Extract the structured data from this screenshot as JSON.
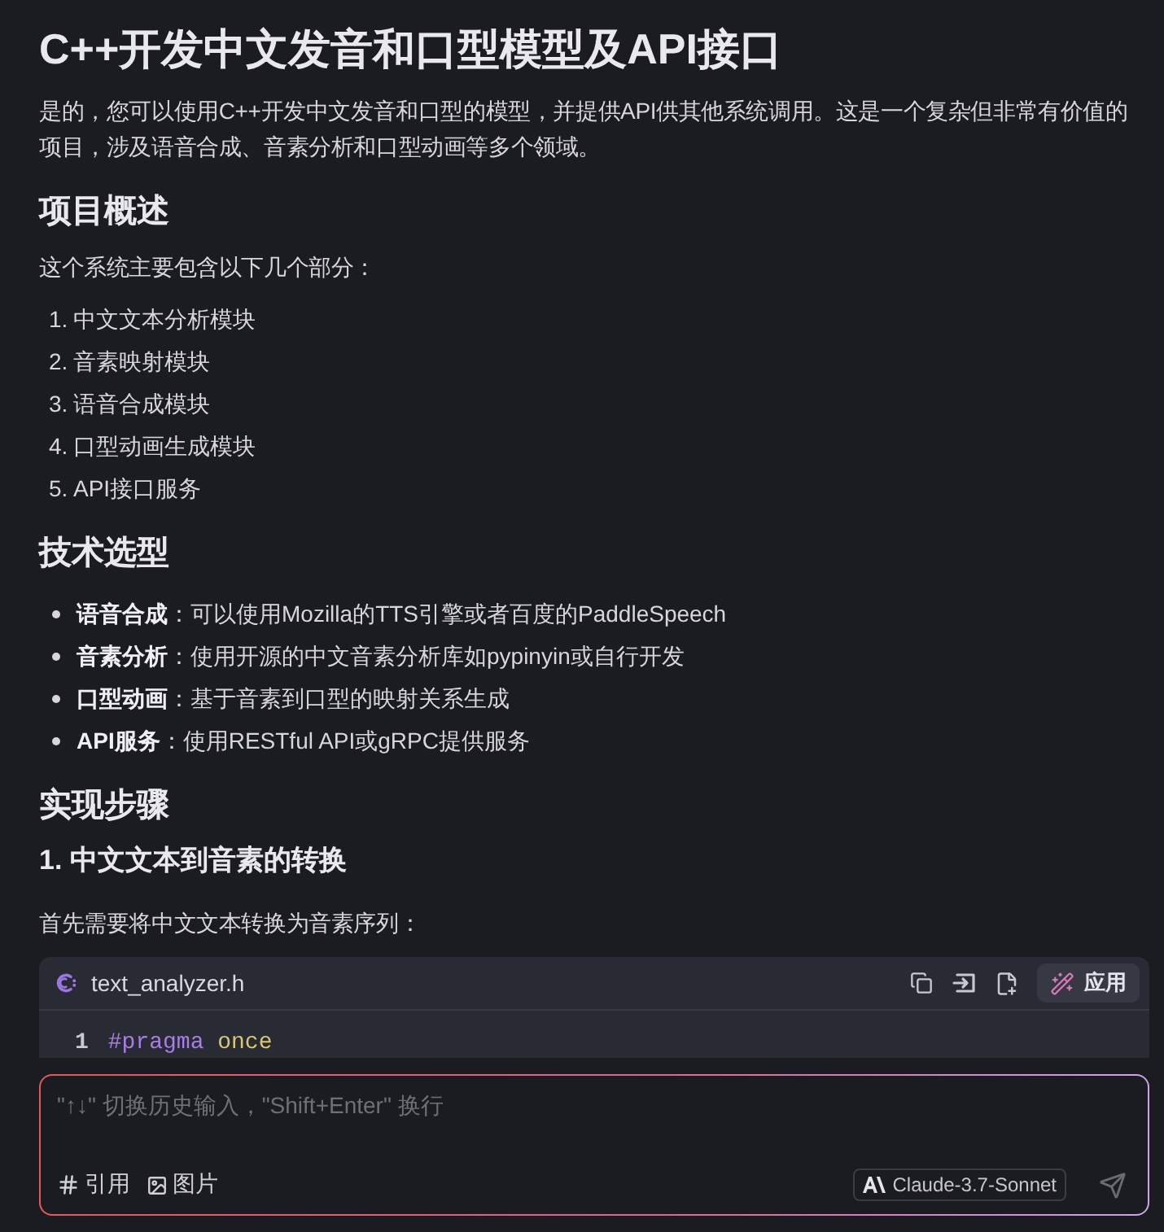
{
  "content": [
    {
      "kind": "heading1",
      "text": "C++开发中文发音和口型模型及API接口"
    },
    {
      "kind": "paragraph",
      "text": "是的，您可以使用C++开发中文发音和口型的模型，并提供API供其他系统调用。这是一个复杂但非常有价值的项目，涉及语音合成、音素分析和口型动画等多个领域。"
    },
    {
      "kind": "heading2",
      "text": "项目概述"
    },
    {
      "kind": "paragraph",
      "text": "这个系统主要包含以下几个部分："
    },
    {
      "kind": "ordered_list",
      "items": [
        {
          "number": "1.",
          "text": "中文文本分析模块"
        },
        {
          "number": "2.",
          "text": "音素映射模块"
        },
        {
          "number": "3.",
          "text": "语音合成模块"
        },
        {
          "number": "4.",
          "text": "口型动画生成模块"
        },
        {
          "number": "5.",
          "text": "API接口服务"
        }
      ]
    },
    {
      "kind": "heading2",
      "text": "技术选型"
    },
    {
      "kind": "bullet_list",
      "items": [
        "**语音合成**：可以使用Mozilla的TTS引擎或者百度的PaddleSpeech",
        "**音素分析**：使用开源的中文音素分析库如pypinyin或自行开发",
        "**口型动画**：基于音素到口型的映射关系生成",
        "**API服务**：使用RESTful API或gRPC提供服务"
      ]
    },
    {
      "kind": "heading2",
      "text": "实现步骤"
    },
    {
      "kind": "heading3",
      "text": "1. 中文文本到音素的转换"
    },
    {
      "kind": "paragraph",
      "text": "首先需要将中文文本转换为音素序列："
    },
    {
      "kind": "code",
      "filename": "text_analyzer.h",
      "apply_label": "应用",
      "lines": [
        {
          "number": "1",
          "tokens": [
            {
              "kind": "directive",
              "text": "#pragma"
            },
            {
              "kind": "identifier",
              "text": "once"
            }
          ]
        }
      ]
    }
  ],
  "composer": {
    "placeholder": "\"↑↓\" 切换历史输入，\"Shift+Enter\" 换行",
    "actions": [
      "引用",
      "图片"
    ],
    "model": "Claude-3.7-Sonnet"
  }
}
